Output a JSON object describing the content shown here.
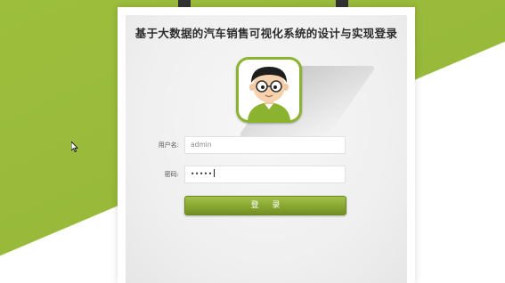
{
  "page": {
    "title": "基于大数据的汽车销售可视化系统的设计与实现登录"
  },
  "form": {
    "username_label": "用户名:",
    "username_value": "admin",
    "password_label": "密码:",
    "password_value": "•••••",
    "login_button": "登 录"
  },
  "colors": {
    "brand_green": "#9dbe3d",
    "button_green": "#8bab34"
  },
  "icons": {
    "avatar": "cartoon-avatar-icon",
    "cursor": "mouse-pointer-icon"
  }
}
